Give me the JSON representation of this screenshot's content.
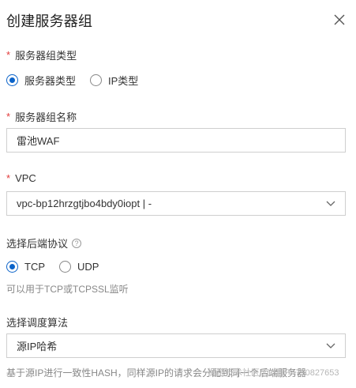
{
  "dialog": {
    "title": "创建服务器组",
    "close_icon": "close-icon"
  },
  "server_group_type": {
    "required_mark": "*",
    "label": "服务器组类型",
    "options": [
      {
        "label": "服务器类型",
        "selected": true
      },
      {
        "label": "IP类型",
        "selected": false
      }
    ]
  },
  "server_group_name": {
    "required_mark": "*",
    "label": "服务器组名称",
    "value": "雷池WAF"
  },
  "vpc": {
    "required_mark": "*",
    "label": "VPC",
    "value": "vpc-bp12hrzgtjbo4bdy0iopt | -"
  },
  "backend_protocol": {
    "label": "选择后端协议",
    "help_icon": "question-circle-icon",
    "help_glyph": "?",
    "options": [
      {
        "label": "TCP",
        "selected": true
      },
      {
        "label": "UDP",
        "selected": false
      }
    ],
    "hint": "可以用于TCP或TCPSSL监听"
  },
  "scheduler": {
    "label": "选择调度算法",
    "value": "源IP哈希",
    "hint": "基于源IP进行一致性HASH，同样源IP的请求会分配到同一个后端服务器"
  },
  "watermark": "掘金技术社区 @ 用户4730827653",
  "colors": {
    "accent": "#0b63c9",
    "required": "#e23b3b"
  }
}
